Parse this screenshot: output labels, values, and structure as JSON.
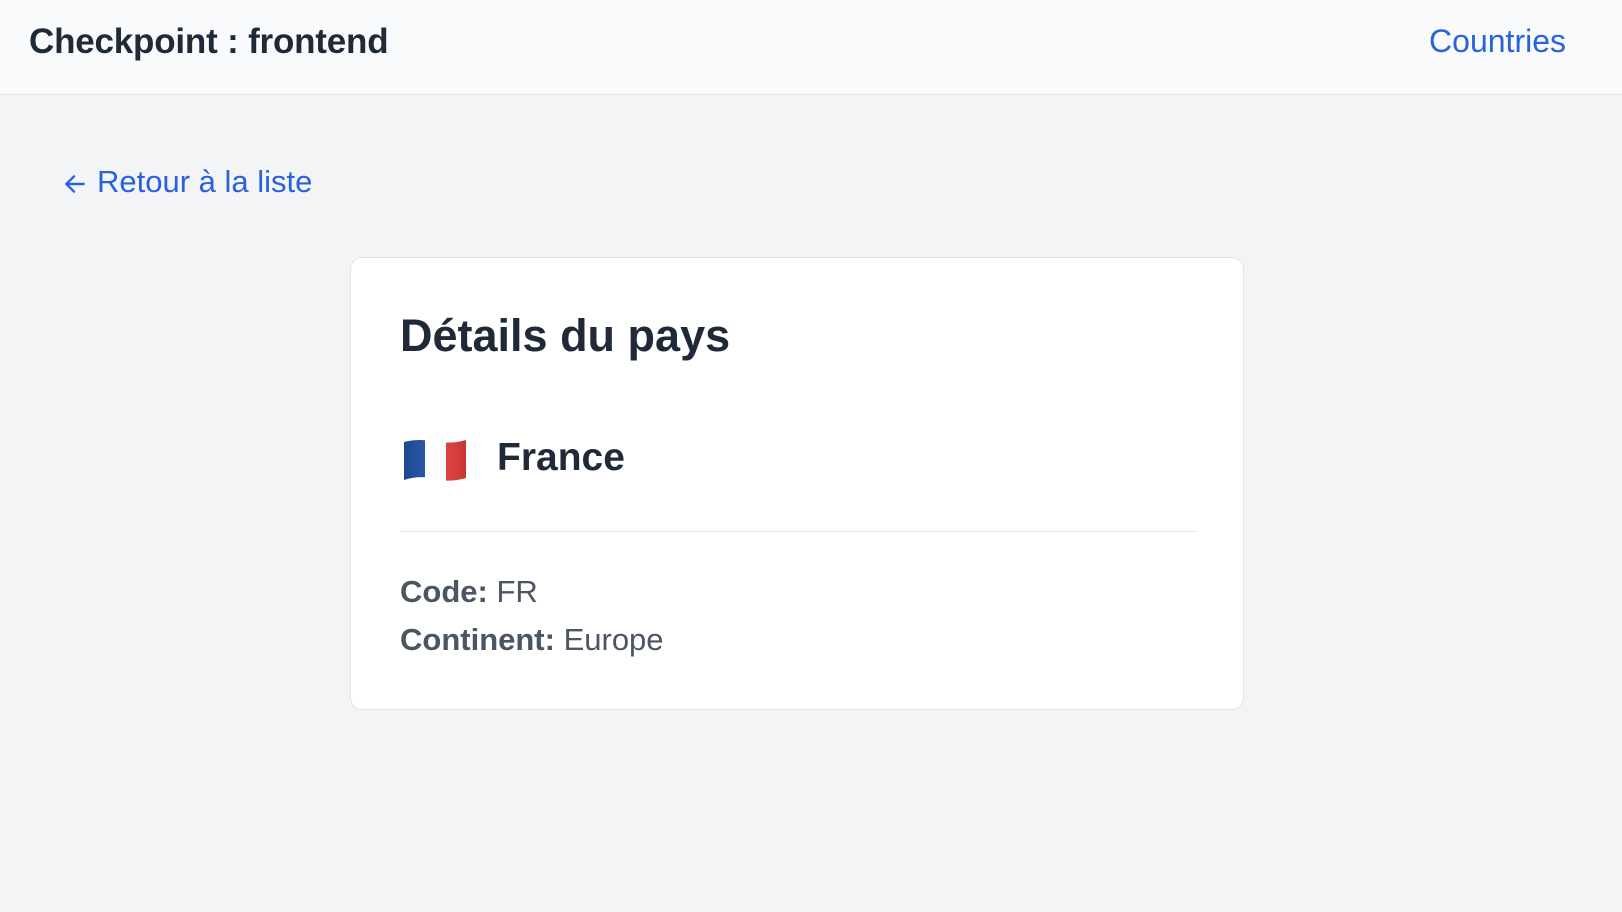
{
  "header": {
    "title": "Checkpoint : frontend",
    "nav_link": "Countries"
  },
  "back_link": {
    "icon": "arrow-left-icon",
    "label": "Retour à la liste"
  },
  "card": {
    "title": "Détails du pays",
    "country": {
      "flag_icon": "flag-france-icon",
      "flag_colors": [
        "#1f4fa3",
        "#ffffff",
        "#e23b3b"
      ],
      "name": "France"
    },
    "details": {
      "code_label": "Code:",
      "code_value": "FR",
      "continent_label": "Continent:",
      "continent_value": "Europe"
    }
  },
  "colors": {
    "accent": "#2b62d9",
    "page_bg": "#f3f4f6",
    "card_bg": "#ffffff",
    "text_primary": "#1f2937",
    "text_secondary": "#4b5563"
  }
}
